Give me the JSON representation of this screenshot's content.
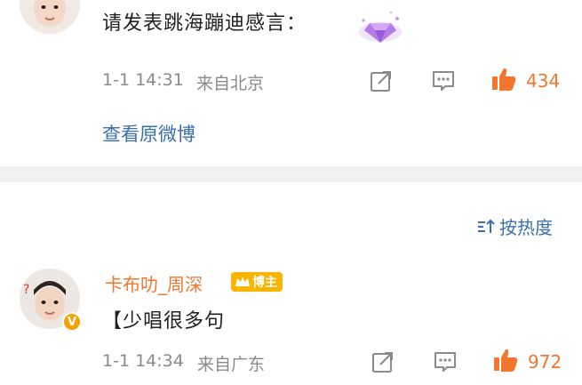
{
  "comment1": {
    "text": "请发表跳海蹦迪感言：",
    "timestamp": "1-1 14:31",
    "location": "来自北京",
    "like_count": "434",
    "view_original": "查看原微博"
  },
  "comments_header": {
    "sort_label": "按热度"
  },
  "comment2": {
    "username": "卡布叻_周深",
    "badge_label": "博主",
    "text": "【少唱很多句",
    "timestamp": "1-1 14:34",
    "location": "来自广东",
    "like_count": "972"
  },
  "colors": {
    "accent_orange": "#f2762e",
    "link_blue": "#3b6fb0",
    "meta_gray": "#8a8a8a",
    "divider": "#f2f2f2"
  }
}
